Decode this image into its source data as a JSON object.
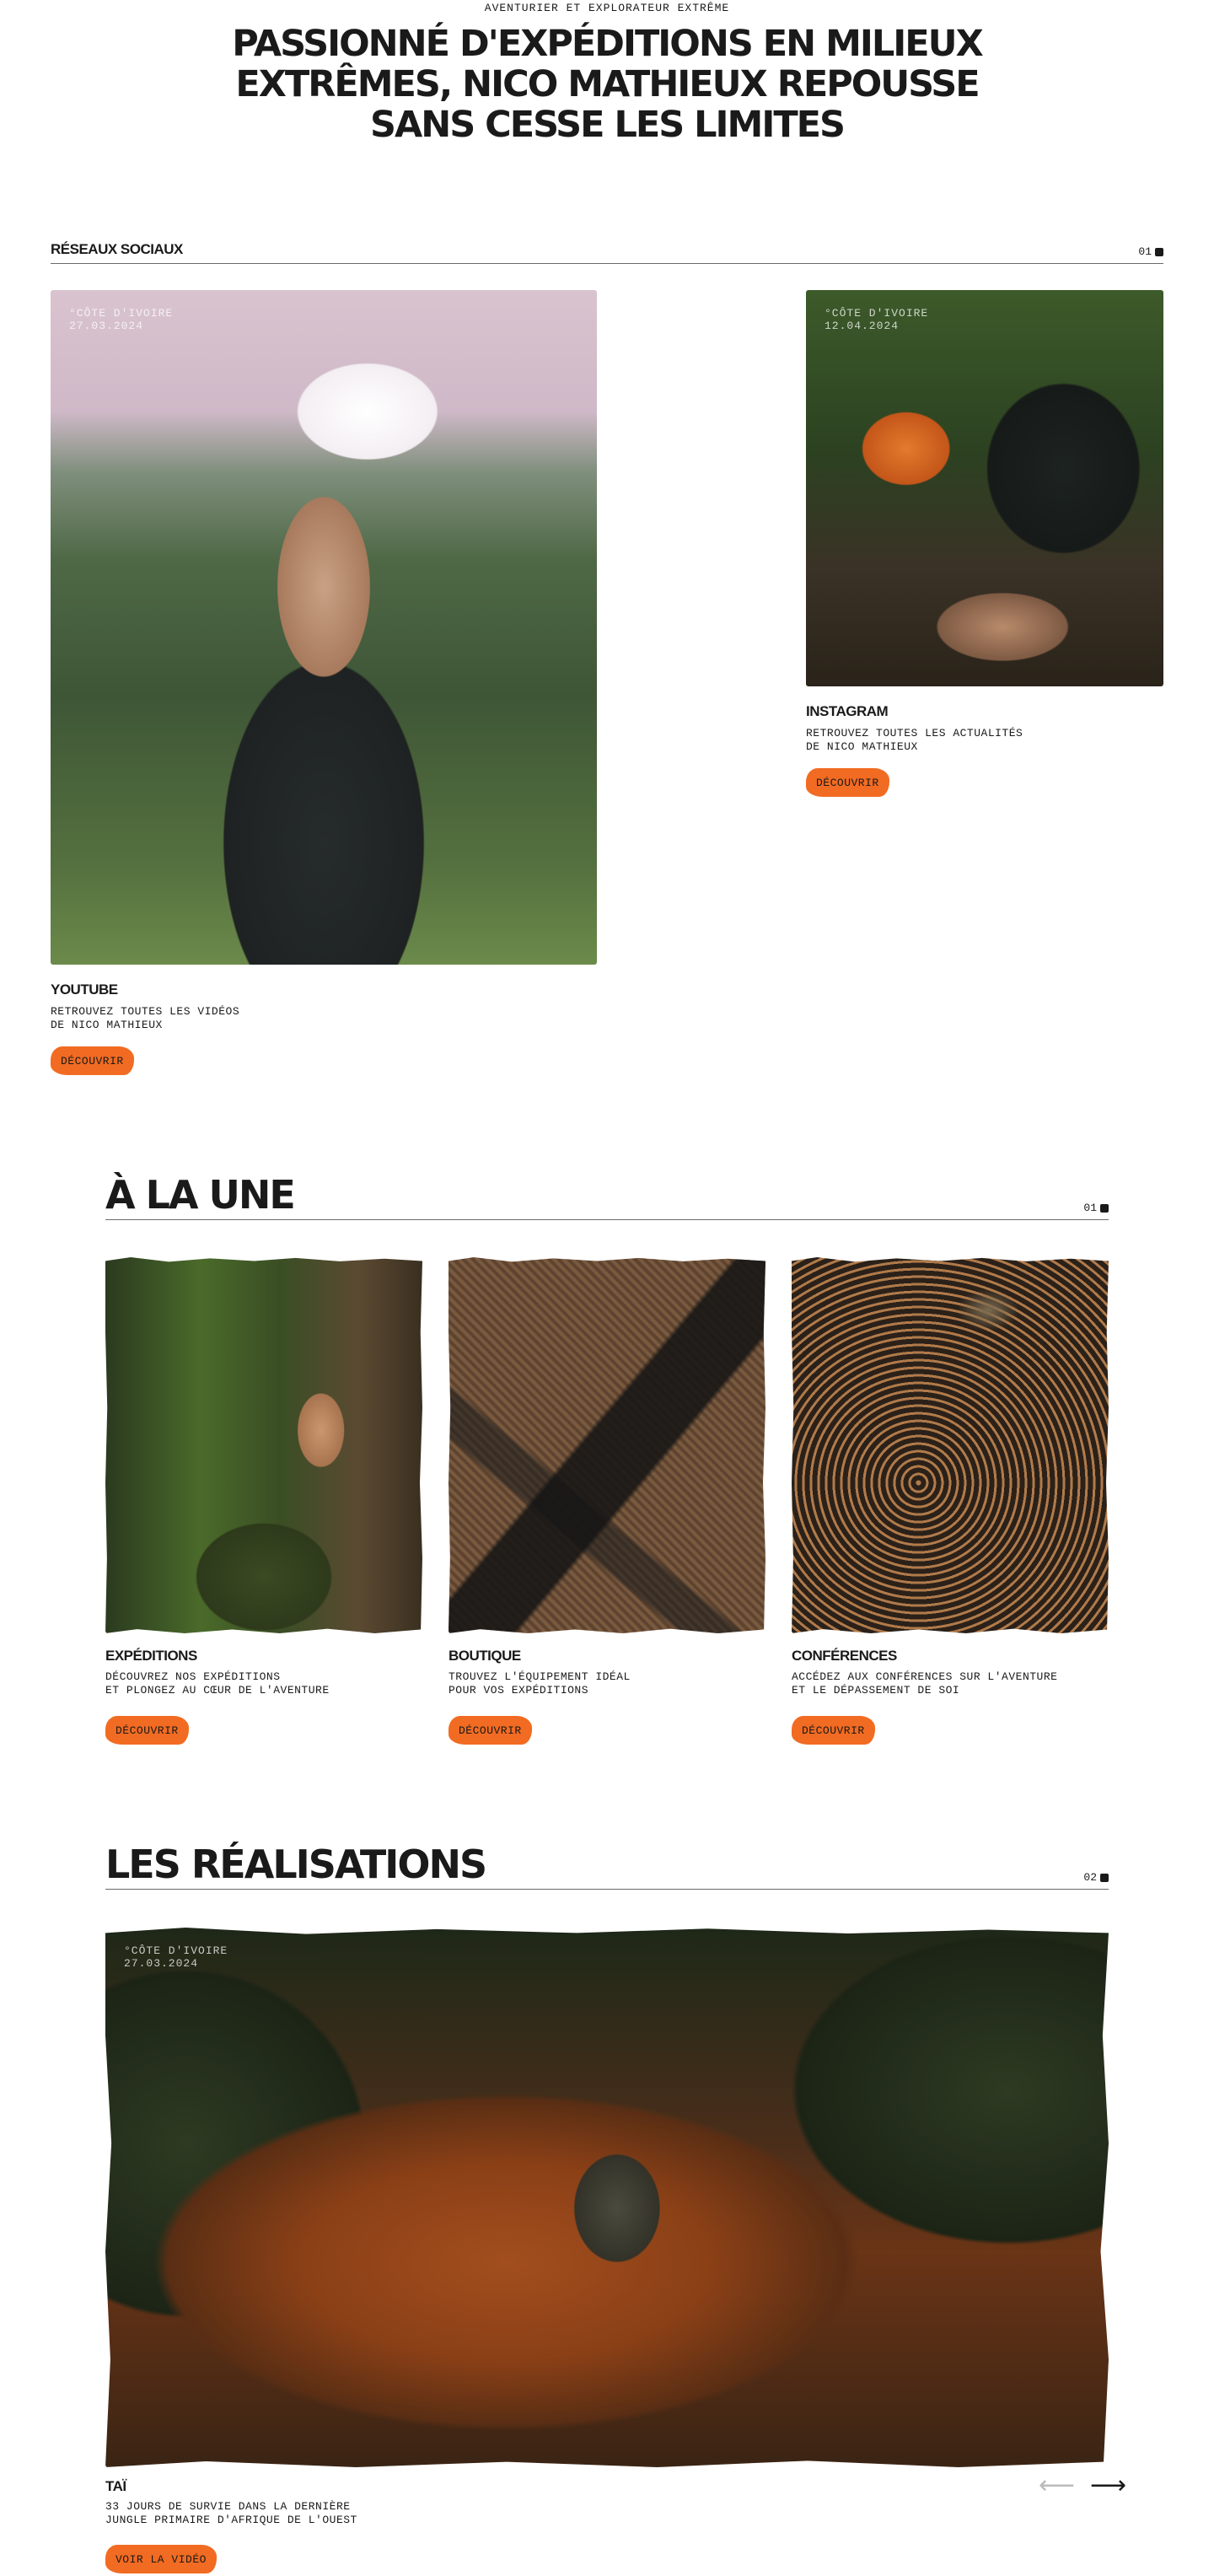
{
  "hero": {
    "eyebrow": "AVENTURIER ET EXPLORATEUR EXTRÊME",
    "title": "PASSIONNÉ D'EXPÉDITIONS EN MILIEUX EXTRÊMES, NICO MATHIEUX REPOUSSE SANS CESSE LES LIMITES"
  },
  "social": {
    "heading": "RÉSEAUX SOCIAUX",
    "number": "01",
    "youtube": {
      "meta_place": "°CÔTE D'IVOIRE",
      "meta_date": "27.03.2024",
      "title": "YOUTUBE",
      "desc_line1": "RETROUVEZ TOUTES LES VIDÉOS",
      "desc_line2": "DE NICO MATHIEUX",
      "button": "DÉCOUVRIR"
    },
    "instagram": {
      "meta_place": "°CÔTE D'IVOIRE",
      "meta_date": "12.04.2024",
      "title": "INSTAGRAM",
      "desc_line1": "RETROUVEZ TOUTES LES ACTUALITÉS",
      "desc_line2": "DE NICO MATHIEUX",
      "button": "DÉCOUVRIR"
    }
  },
  "featured": {
    "heading": "À LA UNE",
    "number": "01",
    "cards": [
      {
        "title": "EXPÉDITIONS",
        "desc_line1": "DÉCOUVREZ NOS EXPÉDITIONS",
        "desc_line2": "ET PLONGEZ AU CŒUR DE L'AVENTURE",
        "button": "DÉCOUVRIR"
      },
      {
        "title": "BOUTIQUE",
        "desc_line1": "TROUVEZ L'ÉQUIPEMENT IDÉAL",
        "desc_line2": "POUR VOS EXPÉDITIONS",
        "button": "DÉCOUVRIR"
      },
      {
        "title": "CONFÉRENCES",
        "desc_line1": "ACCÉDEZ AUX CONFÉRENCES SUR L'AVENTURE",
        "desc_line2": "ET LE DÉPASSEMENT DE SOI",
        "button": "DÉCOUVRIR"
      }
    ]
  },
  "works": {
    "heading": "LES RÉALISATIONS",
    "number": "02",
    "meta_place": "°CÔTE D'IVOIRE",
    "meta_date": "27.03.2024",
    "title": "TAÏ",
    "desc_line1": "33 JOURS DE SURVIE DANS LA DERNIÈRE",
    "desc_line2": "JUNGLE PRIMAIRE D'AFRIQUE DE L'OUEST",
    "button": "VOIR LA VIDÉO",
    "prev_icon": "arrow-left-icon",
    "next_icon": "arrow-right-icon"
  },
  "colors": {
    "accent": "#f26b22",
    "text": "#1a1a1a",
    "background": "#ffffff"
  }
}
